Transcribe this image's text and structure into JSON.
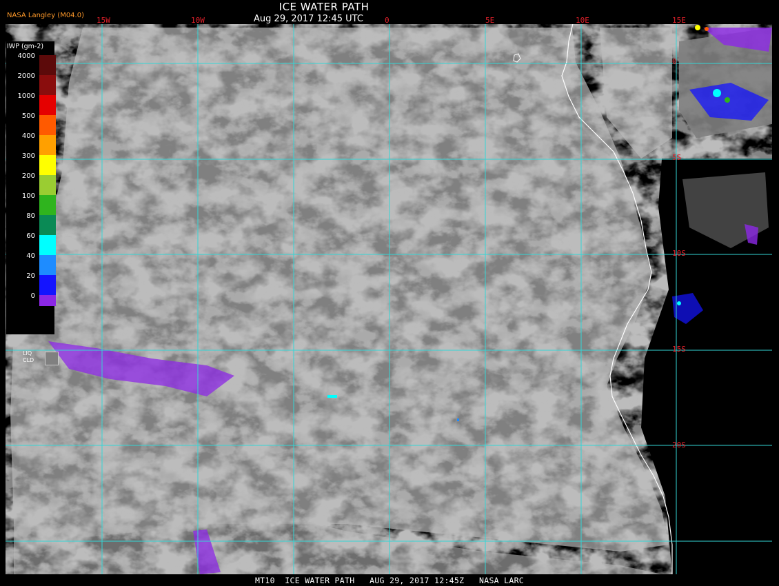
{
  "title": "ICE WATER PATH",
  "subtitle": "Aug 29, 2017 12:45 UTC",
  "producer": "NASA Langley (M04.0)",
  "footer": "MT10  ICE WATER PATH   AUG 29, 2017 12:45Z   NASA LARC",
  "longitude_labels": [
    "15W",
    "10W",
    "0",
    "5E",
    "10E",
    "15E"
  ],
  "latitude_labels": [
    "0",
    "5S",
    "10S",
    "15S",
    "20S"
  ],
  "legend": {
    "title": "IWP (gm-2)",
    "levels": [
      {
        "label": "4000",
        "color": "#5c0a0a"
      },
      {
        "label": "2000",
        "color": "#8a0d0d"
      },
      {
        "label": "1000",
        "color": "#e50000"
      },
      {
        "label": "500",
        "color": "#ff5a00"
      },
      {
        "label": "400",
        "color": "#ffa000"
      },
      {
        "label": "300",
        "color": "#ffff00"
      },
      {
        "label": "200",
        "color": "#9acd32"
      },
      {
        "label": "100",
        "color": "#2fb41e"
      },
      {
        "label": "80",
        "color": "#0a8a55"
      },
      {
        "label": "60",
        "color": "#00ffff"
      },
      {
        "label": "40",
        "color": "#1e8cff"
      },
      {
        "label": "20",
        "color": "#1414ff"
      },
      {
        "label": "0",
        "color": "#8c28e6"
      }
    ],
    "liquid_cloud_label": "LIQ\nCLD",
    "liquid_cloud_color": "#808080"
  },
  "colors": {
    "grid": "#33d6d6",
    "coast": "#ffffff",
    "cloud": "#808080",
    "background": "#000000",
    "axis_label": "#e0202a"
  }
}
